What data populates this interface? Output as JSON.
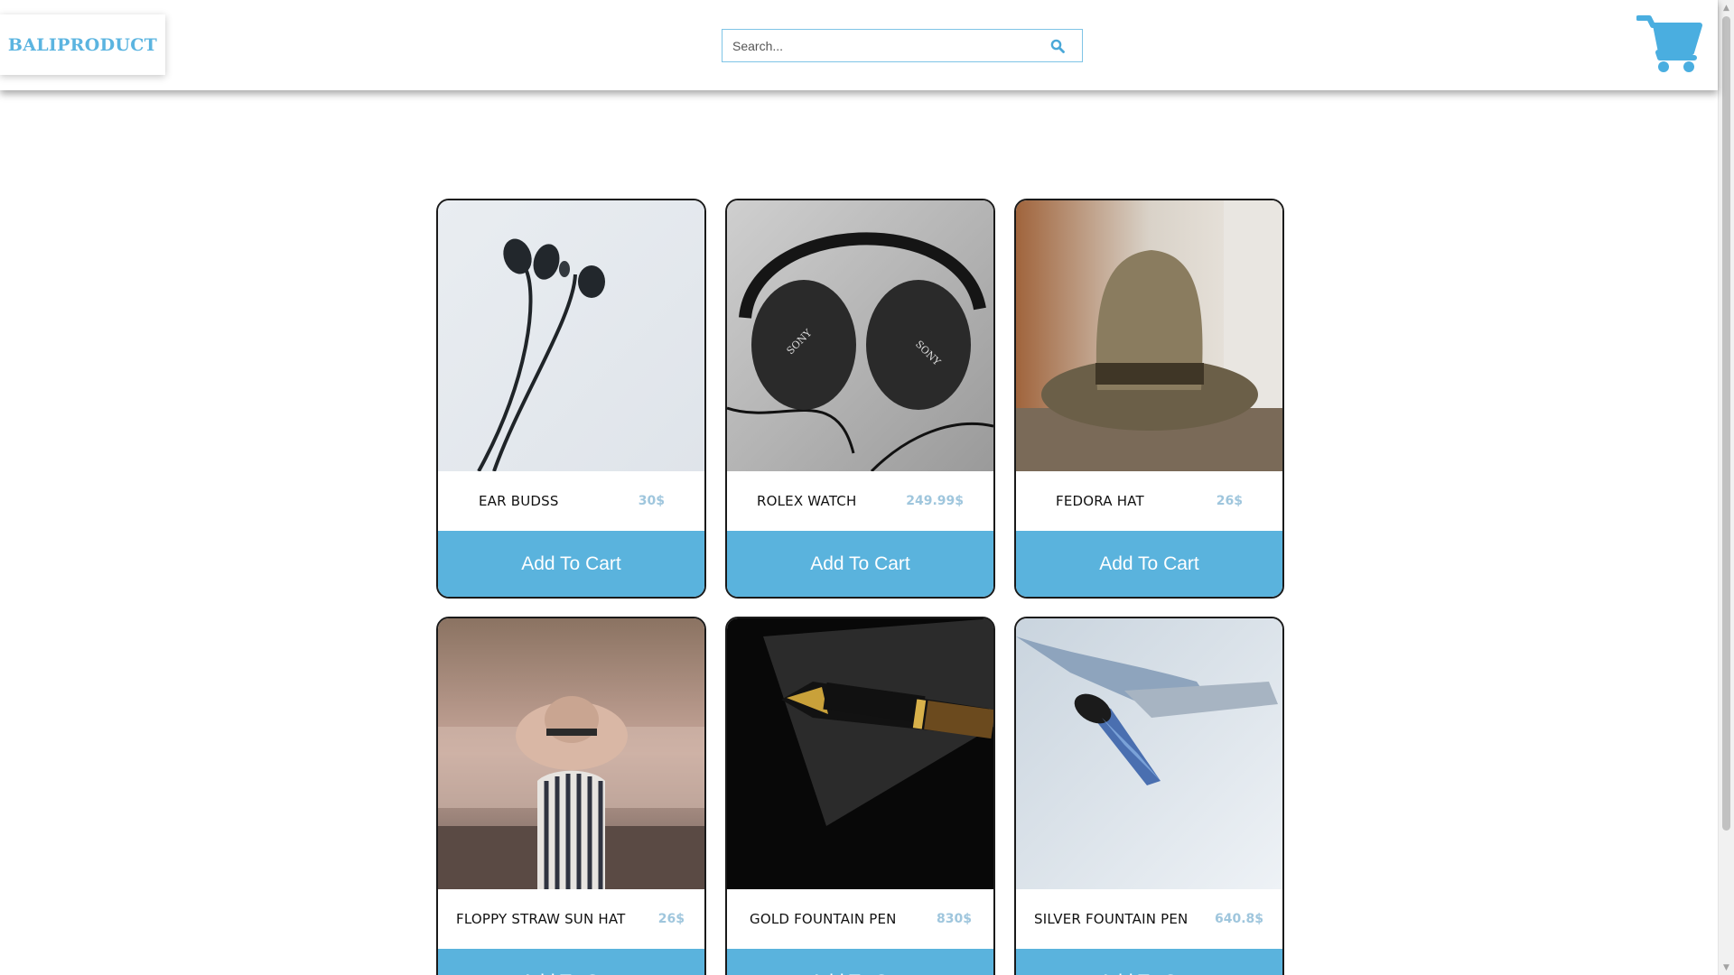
{
  "header": {
    "logo": "BALIPRODUCT",
    "search": {
      "placeholder": "Search...",
      "value": ""
    },
    "icons": {
      "search": "search-icon",
      "cart": "cart-icon"
    }
  },
  "theme": {
    "accent": "#5ab3dd",
    "logo_color": "#5bb4e0",
    "price_color": "#9fc6dd"
  },
  "products": [
    {
      "name": "EAR BUDSS",
      "price": "30$",
      "button": "Add To Cart"
    },
    {
      "name": "ROLEX WATCH",
      "price": "249.99$",
      "button": "Add To Cart"
    },
    {
      "name": "FEDORA HAT",
      "price": "26$",
      "button": "Add To Cart"
    },
    {
      "name": "FLOPPY STRAW SUN HAT",
      "price": "26$",
      "button": "Add To Cart"
    },
    {
      "name": "GOLD FOUNTAIN PEN",
      "price": "830$",
      "button": "Add To Cart"
    },
    {
      "name": "SILVER FOUNTAIN PEN",
      "price": "640.8$",
      "button": "Add To Cart"
    }
  ]
}
